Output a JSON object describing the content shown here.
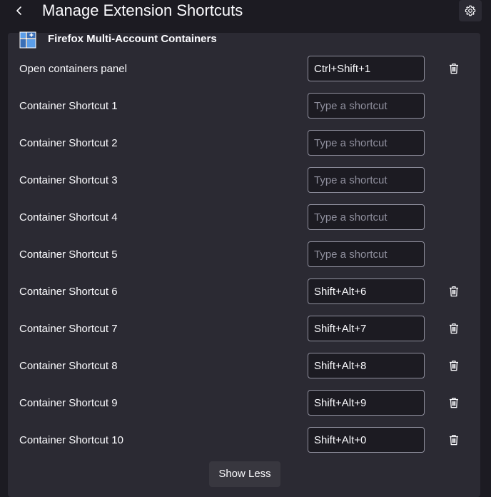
{
  "header": {
    "title": "Manage Extension Shortcuts",
    "back_icon": "chevron-left-icon",
    "settings_icon": "gear-icon"
  },
  "extension": {
    "name": "Firefox Multi-Account Containers",
    "icon": "containers-grid-icon",
    "shortcuts": [
      {
        "label": "Open containers panel",
        "value": "Ctrl+Shift+1",
        "placeholder": "Type a shortcut",
        "has_delete": true
      },
      {
        "label": "Container Shortcut 1",
        "value": "",
        "placeholder": "Type a shortcut",
        "has_delete": false
      },
      {
        "label": "Container Shortcut 2",
        "value": "",
        "placeholder": "Type a shortcut",
        "has_delete": false
      },
      {
        "label": "Container Shortcut 3",
        "value": "",
        "placeholder": "Type a shortcut",
        "has_delete": false
      },
      {
        "label": "Container Shortcut 4",
        "value": "",
        "placeholder": "Type a shortcut",
        "has_delete": false
      },
      {
        "label": "Container Shortcut 5",
        "value": "",
        "placeholder": "Type a shortcut",
        "has_delete": false
      },
      {
        "label": "Container Shortcut 6",
        "value": "Shift+Alt+6",
        "placeholder": "Type a shortcut",
        "has_delete": true
      },
      {
        "label": "Container Shortcut 7",
        "value": "Shift+Alt+7",
        "placeholder": "Type a shortcut",
        "has_delete": true
      },
      {
        "label": "Container Shortcut 8",
        "value": "Shift+Alt+8",
        "placeholder": "Type a shortcut",
        "has_delete": true
      },
      {
        "label": "Container Shortcut 9",
        "value": "Shift+Alt+9",
        "placeholder": "Type a shortcut",
        "has_delete": true
      },
      {
        "label": "Container Shortcut 10",
        "value": "Shift+Alt+0",
        "placeholder": "Type a shortcut",
        "has_delete": true
      }
    ],
    "show_less_label": "Show Less"
  },
  "colors": {
    "page_bg": "#1c1b22",
    "card_bg": "#2b2a33",
    "text": "#fbfbfe",
    "placeholder": "#8f8f9d",
    "icon_blue": "#5b9ee9"
  }
}
